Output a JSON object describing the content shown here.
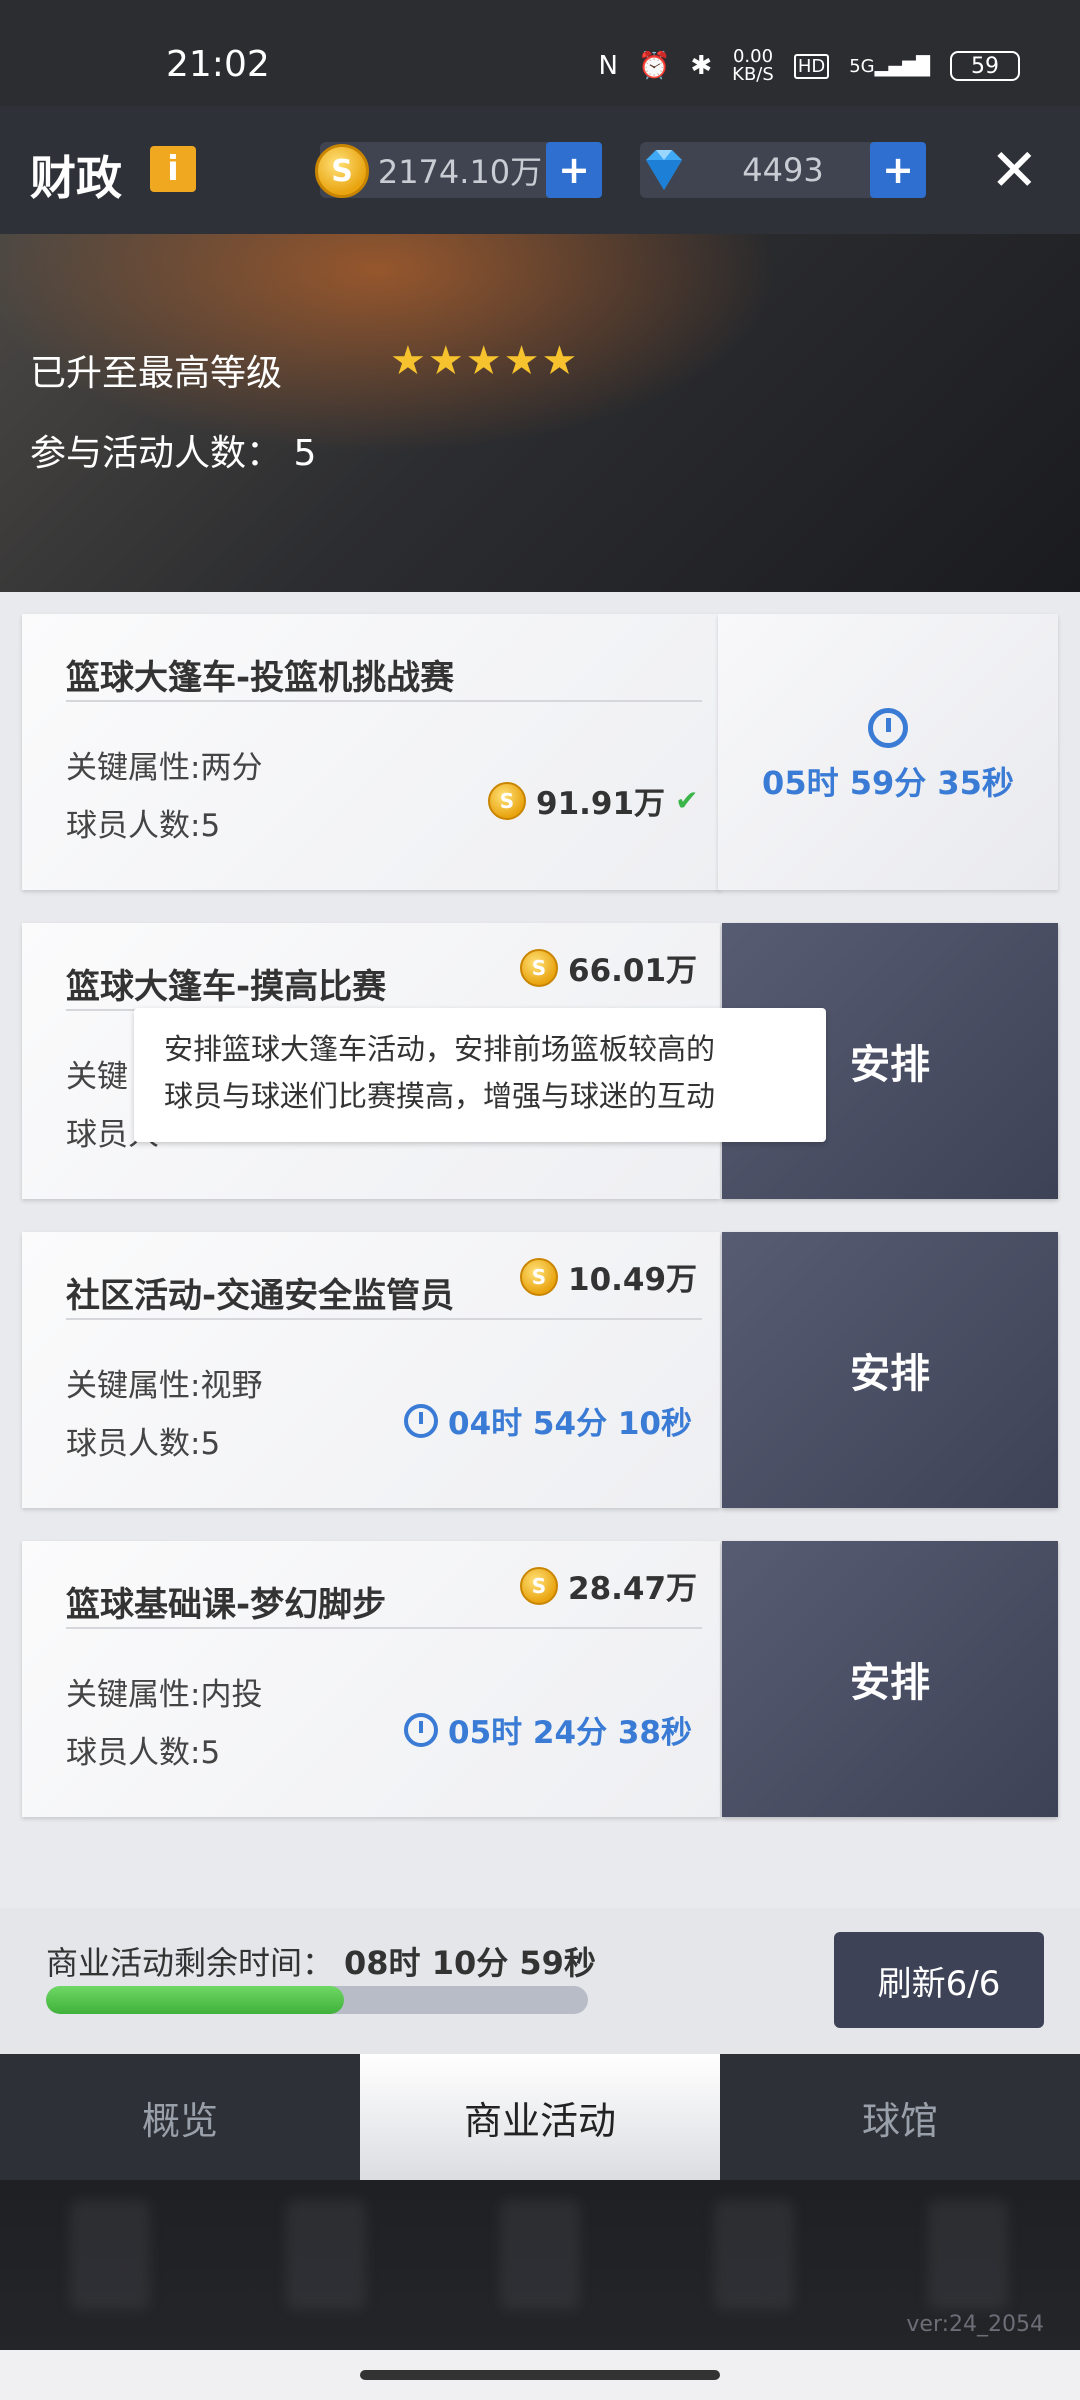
{
  "status_bar": {
    "time": "21:02",
    "net_speed": "0.00",
    "net_unit": "KB/S",
    "hd": "HD",
    "signal": "5G",
    "battery": "59"
  },
  "header": {
    "title": "财政",
    "info_icon": "i",
    "coins": "2174.10万",
    "gems": "4493",
    "plus": "+",
    "close": "✕"
  },
  "hero": {
    "level_text": "已升至最高等级",
    "stars": "★★★★★",
    "participants": "参与活动人数：  5"
  },
  "activities": [
    {
      "title": "篮球大篷车-投篮机挑战赛",
      "attr": "关键属性:两分",
      "count": "球员人数:5",
      "reward": "91.91万",
      "timer": "05时 59分 35秒",
      "state": "in_progress"
    },
    {
      "title": "篮球大篷车-摸高比赛",
      "attr": "关键",
      "count": "球员人",
      "reward": "66.01万",
      "action": "安排"
    },
    {
      "title": "社区活动-交通安全监管员",
      "attr": "关键属性:视野",
      "count": "球员人数:5",
      "reward": "10.49万",
      "timer": "04时 54分 10秒",
      "action": "安排"
    },
    {
      "title": "篮球基础课-梦幻脚步",
      "attr": "关键属性:内投",
      "count": "球员人数:5",
      "reward": "28.47万",
      "timer": "05时 24分 38秒",
      "action": "安排"
    }
  ],
  "tooltip": {
    "line1": "安排篮球大篷车活动，安排前场篮板较高的",
    "line2": "球员与球迷们比赛摸高，增强与球迷的互动"
  },
  "business": {
    "remain_label": "商业活动剩余时间：",
    "remain_time": "08时 10分 59秒",
    "progress": 0.55,
    "refresh": "刷新6/6"
  },
  "tabs": [
    {
      "label": "概览",
      "active": false
    },
    {
      "label": "商业活动",
      "active": true
    },
    {
      "label": "球馆",
      "active": false
    }
  ],
  "version": "ver:24_2054",
  "colors": {
    "accent_blue": "#3a7bd5",
    "header_bg": "#2e3137",
    "action_btn": "#3e4256",
    "progress_green": "#3fb13a",
    "coin_gold": "#e9a410"
  },
  "icons": {
    "coin": "coin-icon",
    "gem": "diamond-icon",
    "timer": "stopwatch-icon",
    "check": "check-icon",
    "close": "close-icon",
    "info": "info-icon"
  }
}
